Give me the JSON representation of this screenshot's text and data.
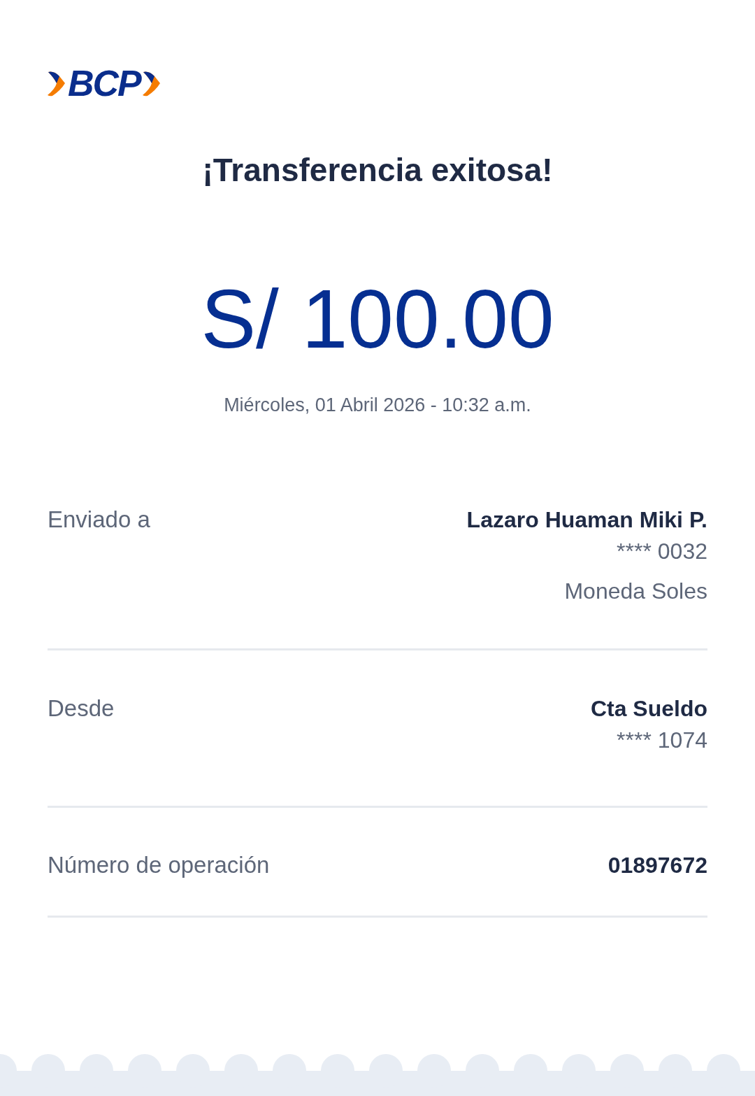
{
  "logo": {
    "text": "BCP"
  },
  "title": "¡Transferencia exitosa!",
  "amount": "S/ 100.00",
  "date": "Miércoles, 01 Abril 2026 - 10:32 a.m.",
  "details": [
    {
      "label": "Enviado a",
      "lines": [
        {
          "text": "Lazaro Huaman Miki P.",
          "kind": "strong"
        },
        {
          "text": "**** 0032",
          "kind": "plain"
        },
        {
          "text": "Moneda Soles",
          "kind": "plain"
        }
      ]
    },
    {
      "label": "Desde",
      "lines": [
        {
          "text": "Cta Sueldo",
          "kind": "strong"
        },
        {
          "text": "**** 1074",
          "kind": "plain"
        }
      ]
    },
    {
      "label": "Número de operación",
      "lines": [
        {
          "text": "01897672",
          "kind": "strong"
        }
      ]
    }
  ]
}
